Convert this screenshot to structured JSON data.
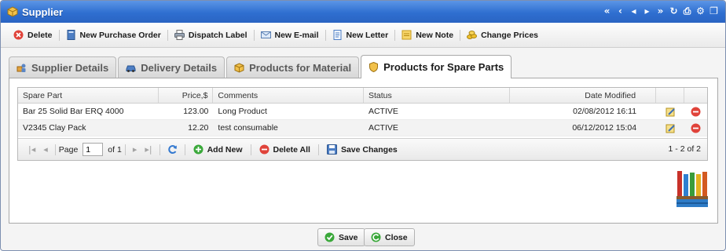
{
  "window": {
    "title": "Supplier"
  },
  "title_tools": [
    "first-icon",
    "prev-icon",
    "left-icon",
    "right-icon",
    "next-icon",
    "refresh-icon",
    "print-icon",
    "settings-icon",
    "maximize-icon"
  ],
  "toolbar": {
    "delete": "Delete",
    "new_purchase_order": "New Purchase Order",
    "dispatch_label": "Dispatch Label",
    "new_email": "New E-mail",
    "new_letter": "New Letter",
    "new_note": "New Note",
    "change_prices": "Change Prices"
  },
  "tabs": [
    {
      "label": "Supplier Details"
    },
    {
      "label": "Delivery Details"
    },
    {
      "label": "Products for Material"
    },
    {
      "label": "Products for Spare Parts",
      "active": true
    }
  ],
  "grid": {
    "columns": [
      "Spare Part",
      "Price,$",
      "Comments",
      "Status",
      "Date Modified"
    ],
    "rows": [
      {
        "part": "Bar 25 Solid Bar ERQ 4000",
        "price": "123.00",
        "comments": "Long Product",
        "status": "ACTIVE",
        "date": "02/08/2012 16:11"
      },
      {
        "part": "V2345 Clay Pack",
        "price": "12.20",
        "comments": "test consumable",
        "status": "ACTIVE",
        "date": "06/12/2012 15:04"
      }
    ]
  },
  "pager": {
    "page_label": "Page",
    "page_value": "1",
    "of_label": "of 1",
    "add_new": "Add New",
    "delete_all": "Delete All",
    "save_changes": "Save Changes",
    "count": "1 - 2 of 2"
  },
  "footer": {
    "save": "Save",
    "close": "Close"
  },
  "colors": {
    "titlebar": "#2f6fd0",
    "delete_red": "#e0433a",
    "add_green": "#3aa83a"
  }
}
